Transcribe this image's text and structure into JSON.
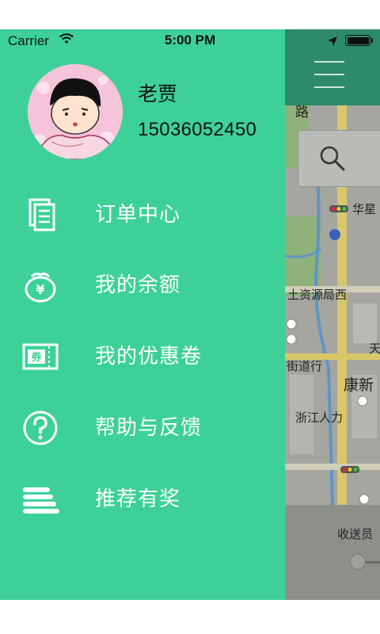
{
  "status_bar": {
    "carrier": "Carrier",
    "time": "5:00 PM",
    "battery_level": 1.0
  },
  "drawer": {
    "background_color": "#3dd199",
    "user": {
      "name": "老贾",
      "phone": "15036052450"
    },
    "menu": [
      {
        "label": "订单中心",
        "icon": "document-icon"
      },
      {
        "label": "我的余额",
        "icon": "wallet-yen-icon"
      },
      {
        "label": "我的优惠卷",
        "icon": "coupon-icon"
      },
      {
        "label": "帮助与反馈",
        "icon": "help-icon"
      },
      {
        "label": "推荐有奖",
        "icon": "coin-stack-icon"
      }
    ]
  },
  "map": {
    "header_color": "#2d8a6a",
    "labels": [
      "路",
      "华星",
      "土资源局西",
      "天",
      "街道行",
      "康新",
      "浙江人力"
    ],
    "courier_label": "收送员"
  }
}
